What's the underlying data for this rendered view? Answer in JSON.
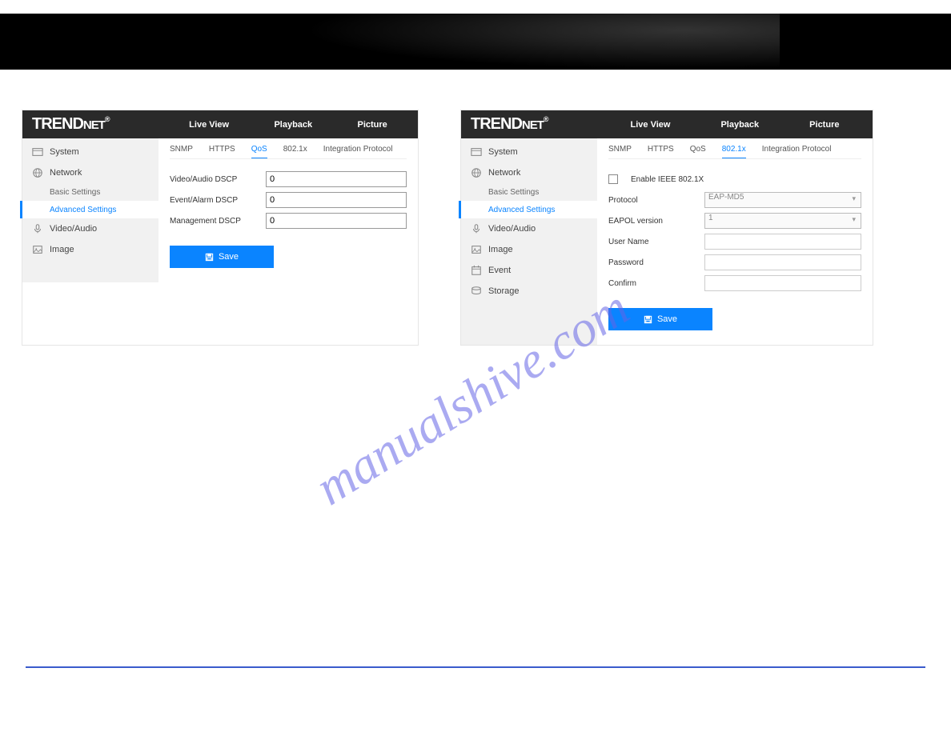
{
  "watermark": "manualshive.com",
  "brand_html": "TRENDNET",
  "hmenu": {
    "live": "Live View",
    "playback": "Playback",
    "picture": "Picture"
  },
  "sidebar": {
    "system": "System",
    "network": "Network",
    "basic": "Basic Settings",
    "advanced": "Advanced Settings",
    "videoaudio": "Video/Audio",
    "image": "Image",
    "event": "Event",
    "storage": "Storage"
  },
  "tabs": {
    "snmp": "SNMP",
    "https": "HTTPS",
    "qos": "QoS",
    "dot1x": "802.1x",
    "integration": "Integration Protocol"
  },
  "left_panel": {
    "fields": {
      "va_dscp": {
        "label": "Video/Audio DSCP",
        "value": "0"
      },
      "ea_dscp": {
        "label": "Event/Alarm DSCP",
        "value": "0"
      },
      "mg_dscp": {
        "label": "Management DSCP",
        "value": "0"
      }
    }
  },
  "right_panel": {
    "enable_label": "Enable IEEE 802.1X",
    "protocol": {
      "label": "Protocol",
      "value": "EAP-MD5"
    },
    "eapol": {
      "label": "EAPOL version",
      "value": "1"
    },
    "username": {
      "label": "User Name",
      "value": ""
    },
    "password": {
      "label": "Password",
      "value": ""
    },
    "confirm": {
      "label": "Confirm",
      "value": ""
    }
  },
  "save_label": "Save"
}
